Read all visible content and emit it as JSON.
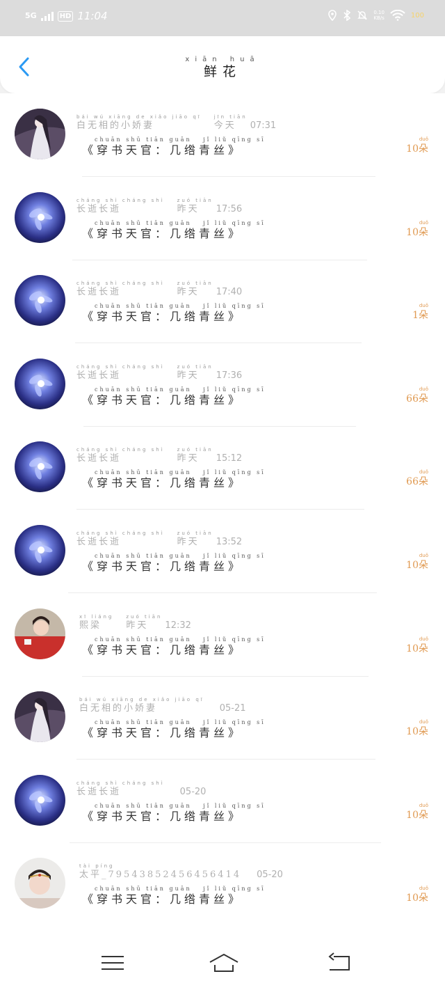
{
  "status_bar": {
    "network": "5G",
    "hd": "HD",
    "time": "11:04",
    "speed_top": "0.10",
    "speed_bottom": "KB/s",
    "battery": "100"
  },
  "header": {
    "title_pinyin": "xiān huā",
    "title": "鲜花",
    "back_icon": "chevron-left-icon"
  },
  "colors": {
    "accent_blue": "#2b9af3",
    "flower_count": "#e09a52"
  },
  "records": [
    {
      "name_pinyin": "bái wú xiāng de xiǎo jiāo qī",
      "name": "白无相的小娇妻",
      "time_pinyin": "jīn tiān",
      "time_label": "今天",
      "time": "07:31",
      "book_pinyin": "chuān shū tiān guān   jǐ liǔ qīng sī",
      "book": "《穿书天官：几绺青丝》",
      "count_pinyin": "duǒ",
      "count": "10朵",
      "avatar": "hanfu-figure"
    },
    {
      "name_pinyin": "cháng shì cháng shì",
      "name": "长逝长逝",
      "time_pinyin": "zuó tiān",
      "time_label": "昨天",
      "time": "17:56",
      "book_pinyin": "chuān shū tiān guān   jǐ liǔ qīng sī",
      "book": "《穿书天官：几绺青丝》",
      "count_pinyin": "duǒ",
      "count": "10朵",
      "avatar": "blue-flower"
    },
    {
      "name_pinyin": "cháng shì cháng shì",
      "name": "长逝长逝",
      "time_pinyin": "zuó tiān",
      "time_label": "昨天",
      "time": "17:40",
      "book_pinyin": "chuān shū tiān guān   jǐ liǔ qīng sī",
      "book": "《穿书天官：几绺青丝》",
      "count_pinyin": "duǒ",
      "count": "1朵",
      "avatar": "blue-flower"
    },
    {
      "name_pinyin": "cháng shì cháng shì",
      "name": "长逝长逝",
      "time_pinyin": "zuó tiān",
      "time_label": "昨天",
      "time": "17:36",
      "book_pinyin": "chuān shū tiān guān   jǐ liǔ qīng sī",
      "book": "《穿书天官：几绺青丝》",
      "count_pinyin": "duǒ",
      "count": "66朵",
      "avatar": "blue-flower"
    },
    {
      "name_pinyin": "cháng shì cháng shì",
      "name": "长逝长逝",
      "time_pinyin": "zuó tiān",
      "time_label": "昨天",
      "time": "15:12",
      "book_pinyin": "chuān shū tiān guān   jǐ liǔ qīng sī",
      "book": "《穿书天官：几绺青丝》",
      "count_pinyin": "duǒ",
      "count": "66朵",
      "avatar": "blue-flower"
    },
    {
      "name_pinyin": "cháng shì cháng shì",
      "name": "长逝长逝",
      "time_pinyin": "zuó tiān",
      "time_label": "昨天",
      "time": "13:52",
      "book_pinyin": "chuān shū tiān guān   jǐ liǔ qīng sī",
      "book": "《穿书天官：几绺青丝》",
      "count_pinyin": "duǒ",
      "count": "10朵",
      "avatar": "blue-flower"
    },
    {
      "name_pinyin": "xī liáng",
      "name": "熙梁",
      "time_pinyin": "zuó tiān",
      "time_label": "昨天",
      "time": "12:32",
      "book_pinyin": "chuān shū tiān guān   jǐ liǔ qīng sī",
      "book": "《穿书天官：几绺青丝》",
      "count_pinyin": "duǒ",
      "count": "10朵",
      "avatar": "red-dress-girl"
    },
    {
      "name_pinyin": "bái wú xiāng de xiǎo jiāo qī",
      "name": "白无相的小娇妻",
      "time_pinyin": "",
      "time_label": "",
      "time": "05-21",
      "book_pinyin": "chuān shū tiān guān   jǐ liǔ qīng sī",
      "book": "《穿书天官：几绺青丝》",
      "count_pinyin": "duǒ",
      "count": "10朵",
      "avatar": "hanfu-figure"
    },
    {
      "name_pinyin": "cháng shì cháng shì",
      "name": "长逝长逝",
      "time_pinyin": "",
      "time_label": "",
      "time": "05-20",
      "book_pinyin": "chuān shū tiān guān   jǐ liǔ qīng sī",
      "book": "《穿书天官：几绺青丝》",
      "count_pinyin": "duǒ",
      "count": "10朵",
      "avatar": "blue-flower"
    },
    {
      "name_pinyin": "tài píng",
      "name": "太平_79543852456456414",
      "time_pinyin": "",
      "time_label": "",
      "time": "05-20",
      "book_pinyin": "chuān shū tiān guān   jǐ liǔ qīng sī",
      "book": "《穿书天官：几绺青丝》",
      "count_pinyin": "duǒ",
      "count": "10朵",
      "avatar": "girl-headdress"
    }
  ],
  "nav_bar": {
    "menu_icon": "menu-icon",
    "home_icon": "home-icon",
    "back_icon": "back-icon"
  }
}
